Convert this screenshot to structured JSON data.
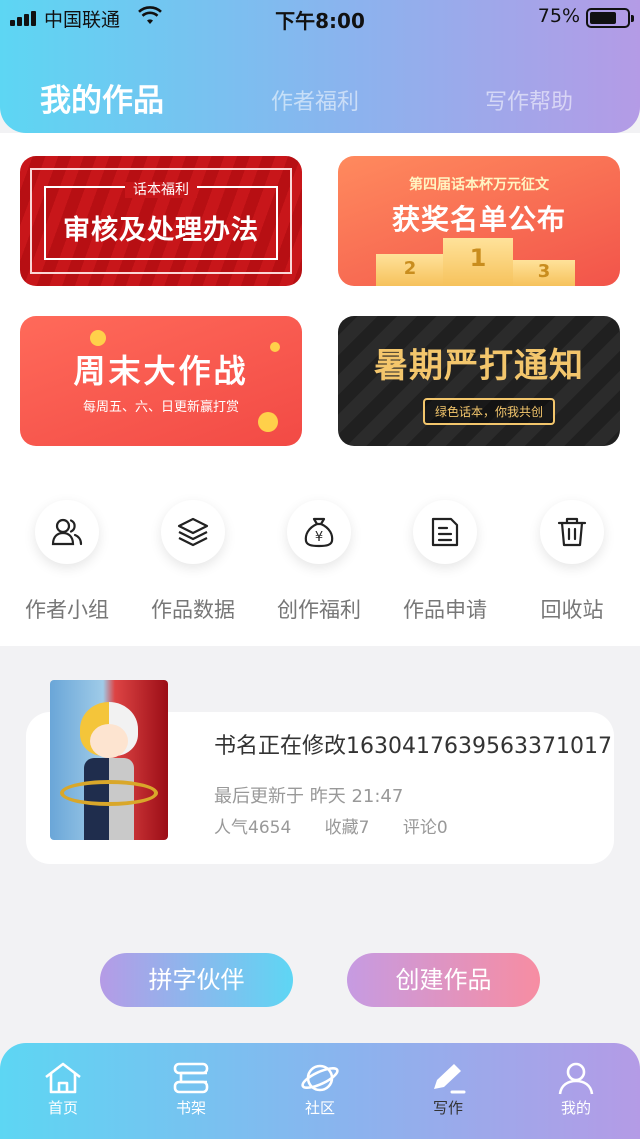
{
  "status_bar": {
    "carrier": "中国联通",
    "time": "下午8:00",
    "battery_percent": "75%",
    "battery_level": 0.75
  },
  "header": {
    "tabs": [
      {
        "label": "我的作品",
        "active": true
      },
      {
        "label": "作者福利",
        "active": false
      },
      {
        "label": "写作帮助",
        "active": false
      }
    ]
  },
  "banners": [
    {
      "tag": "话本福利",
      "title": "审核及处理办法"
    },
    {
      "subtitle": "第四届话本杯万元征文",
      "title": "获奖名单公布",
      "podium": [
        "2",
        "1",
        "3"
      ]
    },
    {
      "title": "周末大作战",
      "subtitle": "每周五、六、日更新赢打赏"
    },
    {
      "title": "暑期严打通知",
      "subtitle": "绿色话本，你我共创"
    }
  ],
  "tools": [
    {
      "label": "作者小组",
      "icon": "author-group-icon"
    },
    {
      "label": "作品数据",
      "icon": "layers-icon"
    },
    {
      "label": "创作福利",
      "icon": "money-bag-icon"
    },
    {
      "label": "作品申请",
      "icon": "document-icon"
    },
    {
      "label": "回收站",
      "icon": "trash-icon"
    }
  ],
  "work": {
    "title": "书名正在修改1630417639563371017",
    "update_text": "最后更新于 昨天 21:47",
    "popularity": "人气4654",
    "favorites": "收藏7",
    "comments": "评论0"
  },
  "actions": {
    "partner_label": "拼字伙伴",
    "create_label": "创建作品"
  },
  "bottom_nav": [
    {
      "label": "首页",
      "icon": "home-icon"
    },
    {
      "label": "书架",
      "icon": "bookshelf-icon"
    },
    {
      "label": "社区",
      "icon": "planet-icon"
    },
    {
      "label": "写作",
      "icon": "pen-icon",
      "active": true
    },
    {
      "label": "我的",
      "icon": "profile-icon"
    }
  ],
  "colors": {
    "header_gradient_start": "#5dd6f3",
    "header_gradient_end": "#b49be6",
    "create_button_end": "#f78da2"
  }
}
